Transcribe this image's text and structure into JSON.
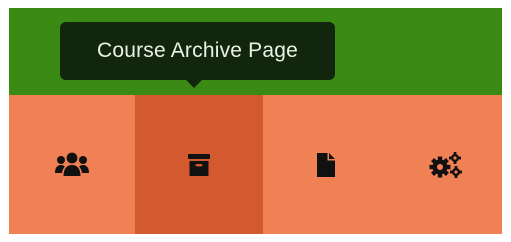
{
  "tooltip": {
    "text": "Course Archive Page"
  },
  "navbar": {
    "items": [
      {
        "icon": "users-icon",
        "active": false
      },
      {
        "icon": "archive-icon",
        "active": true
      },
      {
        "icon": "file-icon",
        "active": false
      },
      {
        "icon": "gears-icon",
        "active": false
      }
    ]
  },
  "colors": {
    "header_bg": "#3b8a14",
    "tooltip_bg": "#12260d",
    "navbar_bg": "#f08155",
    "active_item_bg": "#d3592f",
    "icon": "#111111"
  }
}
